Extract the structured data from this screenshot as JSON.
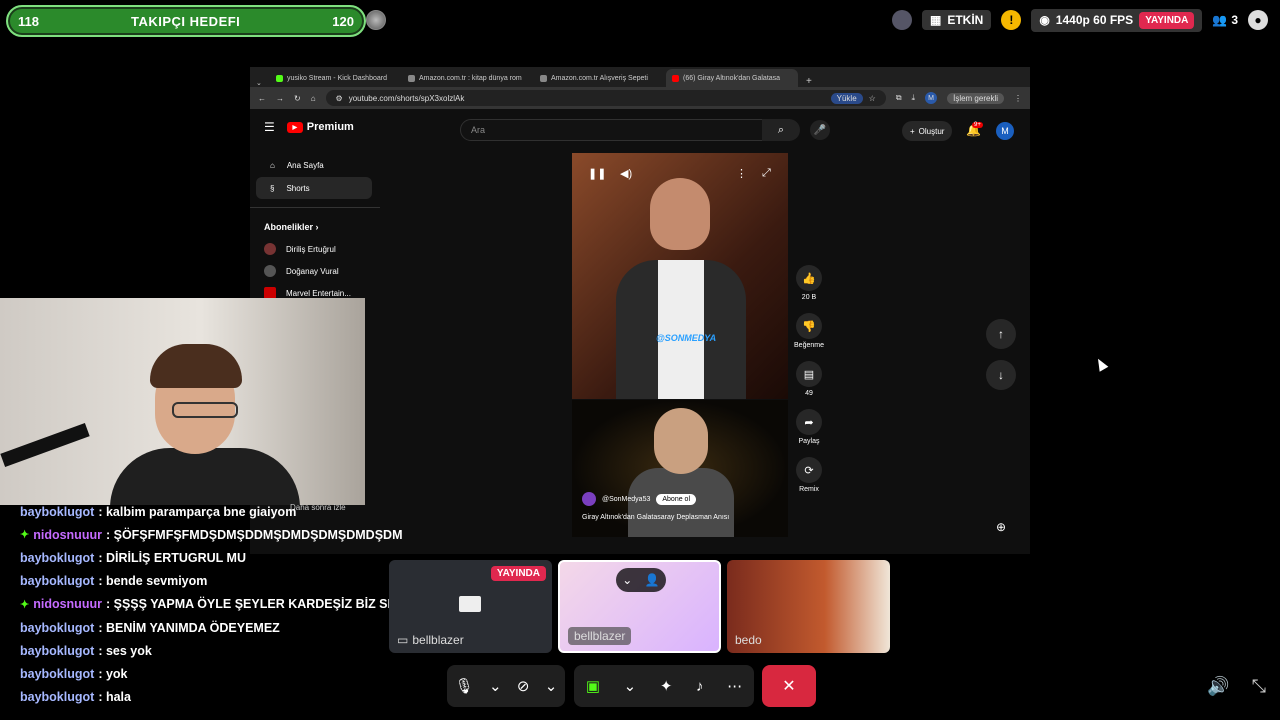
{
  "goal": {
    "current": "118",
    "title": "TAKIPÇI HEDEFI",
    "target": "120"
  },
  "status": {
    "active_label": "ETKİN",
    "quality": "1440p 60 FPS",
    "live": "YAYINDA",
    "viewers": "3"
  },
  "browser": {
    "tabs": [
      {
        "label": "yusiko Stream - Kick Dashboard"
      },
      {
        "label": "Amazon.com.tr : kitap dünya rom"
      },
      {
        "label": "Amazon.com.tr Alışveriş Sepeti"
      },
      {
        "label": "(66) Giray Altınok'dan Galatasa"
      }
    ],
    "url": "youtube.com/shorts/spX3xolzlAk",
    "upload_label": "Yükle",
    "update_label": "İşlem gerekli",
    "profile_initial": "M"
  },
  "youtube": {
    "logo": "Premium",
    "search_placeholder": "Ara",
    "create_label": "Oluştur",
    "notif_count": "9+",
    "sidebar": [
      {
        "label": "Ana Sayfa"
      },
      {
        "label": "Shorts"
      }
    ],
    "subscriptions_label": "Abonelikler",
    "subscriptions": [
      {
        "label": "Diriliş Ertuğrul"
      },
      {
        "label": "Doğanay Vural"
      },
      {
        "label": "Marvel Entertain..."
      }
    ],
    "watch_later": "Daha sonra izle",
    "video_tag": "@SONMEDYA",
    "channel": "@SonMedya53",
    "subscribe_label": "Abone ol",
    "video_title": "Giray Altınok'dan Galatasaray Deplasman Anısı",
    "likes": "20 B",
    "dislike_label": "Beğenme",
    "comments": "49",
    "share_label": "Paylaş",
    "remix_label": "Remix"
  },
  "chat": [
    {
      "user": "bayboklugot",
      "text": "kalbim paramparça bne giaiyom",
      "vip": false
    },
    {
      "user": "nidosnuuur",
      "text": "ŞÖFŞFMFŞFMDŞDMŞDDMŞDMDŞDMŞDMDŞDM",
      "vip": true
    },
    {
      "user": "bayboklugot",
      "text": "DİRİLİŞ ERTUGRUL MU",
      "vip": false
    },
    {
      "user": "bayboklugot",
      "text": "bende sevmiyom",
      "vip": false
    },
    {
      "user": "nidosnuuur",
      "text": "ŞŞŞŞ YAPMA ÖYLE ŞEYLER KARDEŞİZ BİZ SENİNLE",
      "vip": true
    },
    {
      "user": "bayboklugot",
      "text": "BENİM YANIMDA ÖDEYEMEZ",
      "vip": false
    },
    {
      "user": "bayboklugot",
      "text": "ses yok",
      "vip": false
    },
    {
      "user": "bayboklugot",
      "text": "yok",
      "vip": false
    },
    {
      "user": "bayboklugot",
      "text": "hala",
      "vip": false
    }
  ],
  "tiles": [
    {
      "name": "bellblazer",
      "live": "YAYINDA"
    },
    {
      "name": "bellblazer"
    },
    {
      "name": "bedo"
    }
  ]
}
